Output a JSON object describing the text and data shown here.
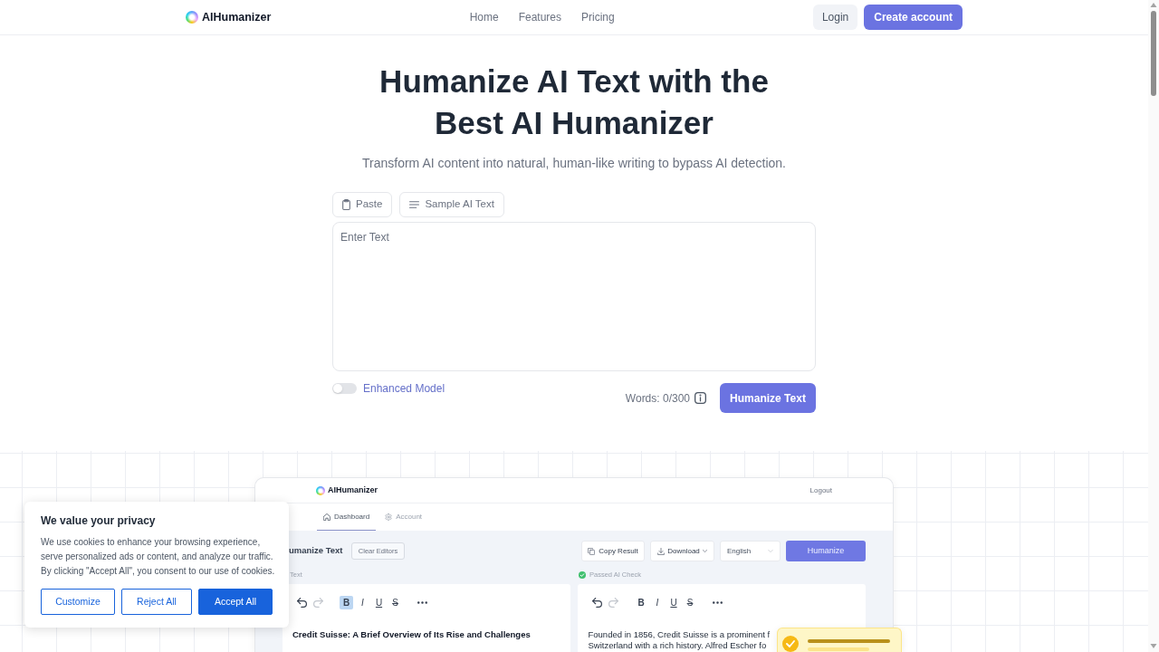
{
  "nav": {
    "brand": "AIHumanizer",
    "links": [
      "Home",
      "Features",
      "Pricing"
    ],
    "login": "Login",
    "create_account": "Create account"
  },
  "hero": {
    "title_lines": [
      "Humanize AI Text with the",
      "Best AI Humanizer"
    ],
    "subtitle": "Transform AI content into natural, human-like writing to bypass AI detection."
  },
  "editor": {
    "actions": [
      {
        "label": "Paste"
      },
      {
        "label": "Sample AI Text"
      }
    ],
    "placeholder": "Enter Text",
    "enhanced_model": {
      "label": "Enhanced Model",
      "on": false
    },
    "word_count": "Words: 0/300",
    "submit": "Humanize Text"
  },
  "preview": {
    "brand": "AIHumanizer",
    "logout": "Logout",
    "tabs": [
      {
        "label": "Dashboard",
        "selected": true
      },
      {
        "label": "Account",
        "selected": false
      }
    ],
    "title": "umanize Text",
    "clear_editors": "Clear Editors",
    "copy_result": "Copy Result",
    "download": "Download",
    "language": "English",
    "humanize": "Humanize",
    "input_label": "Text",
    "status": "Passed AI Check",
    "input_editor": {
      "formats": [
        {
          "kind": "bold",
          "label": "B",
          "selected": true
        },
        {
          "kind": "italic",
          "label": "I",
          "selected": false
        },
        {
          "kind": "underline",
          "label": "U",
          "selected": false
        },
        {
          "kind": "strike",
          "label": "S",
          "selected": false
        }
      ],
      "heading": "Credit Suisse: A Brief Overview of Its Rise and Challenges"
    },
    "output_editor": {
      "formats": [
        {
          "kind": "bold",
          "label": "B",
          "selected": false
        },
        {
          "kind": "italic",
          "label": "I",
          "selected": false
        },
        {
          "kind": "underline",
          "label": "U",
          "selected": false
        },
        {
          "kind": "strike",
          "label": "S",
          "selected": false
        }
      ],
      "lines": [
        "Founded in 1856, Credit Suisse is a prominent f",
        "Switzerland with a rich history. Alfred Escher fo"
      ]
    }
  },
  "cookie_banner": {
    "title": "We value your privacy",
    "body": "We use cookies to enhance your browsing experience, serve personalized ads or content, and analyze our traffic. By clicking \"Accept All\", you consent to our use of cookies.",
    "buttons": [
      {
        "label": "Customize",
        "kind": "outline"
      },
      {
        "label": "Reject All",
        "kind": "outline"
      },
      {
        "label": "Accept All",
        "kind": "primary"
      }
    ]
  }
}
